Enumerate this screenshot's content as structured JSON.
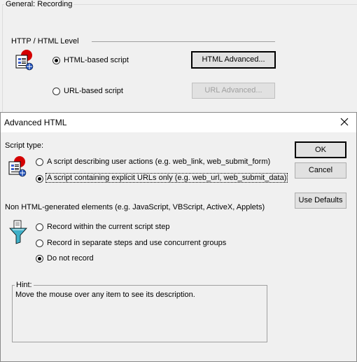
{
  "background": {
    "group_title": "General: Recording",
    "section_title": "HTTP / HTML Level",
    "radio_html": "HTML-based script",
    "radio_url": "URL-based script",
    "btn_html_adv": "HTML Advanced...",
    "btn_url_adv": "URL Advanced...",
    "icon": "script-document-icon"
  },
  "dialog": {
    "title": "Advanced HTML",
    "close_icon": "close-icon",
    "script_type_label": "Script type:",
    "script_options": [
      "A script describing user actions (e.g. web_link, web_submit_form)",
      "A script containing explicit URLs only (e.g. web_url, web_submit_data)"
    ],
    "non_html_label": "Non HTML-generated elements (e.g. JavaScript, VBScript, ActiveX, Applets)",
    "non_html_options": [
      "Record within the current script step",
      "Record in separate steps and use concurrent groups",
      "Do not record"
    ],
    "ok": "OK",
    "cancel": "Cancel",
    "use_defaults": "Use Defaults",
    "hint_label": "Hint:",
    "hint_text": "Move the mouse over any item to see its description.",
    "selected_script_option": 1,
    "selected_non_html_option": 2
  }
}
